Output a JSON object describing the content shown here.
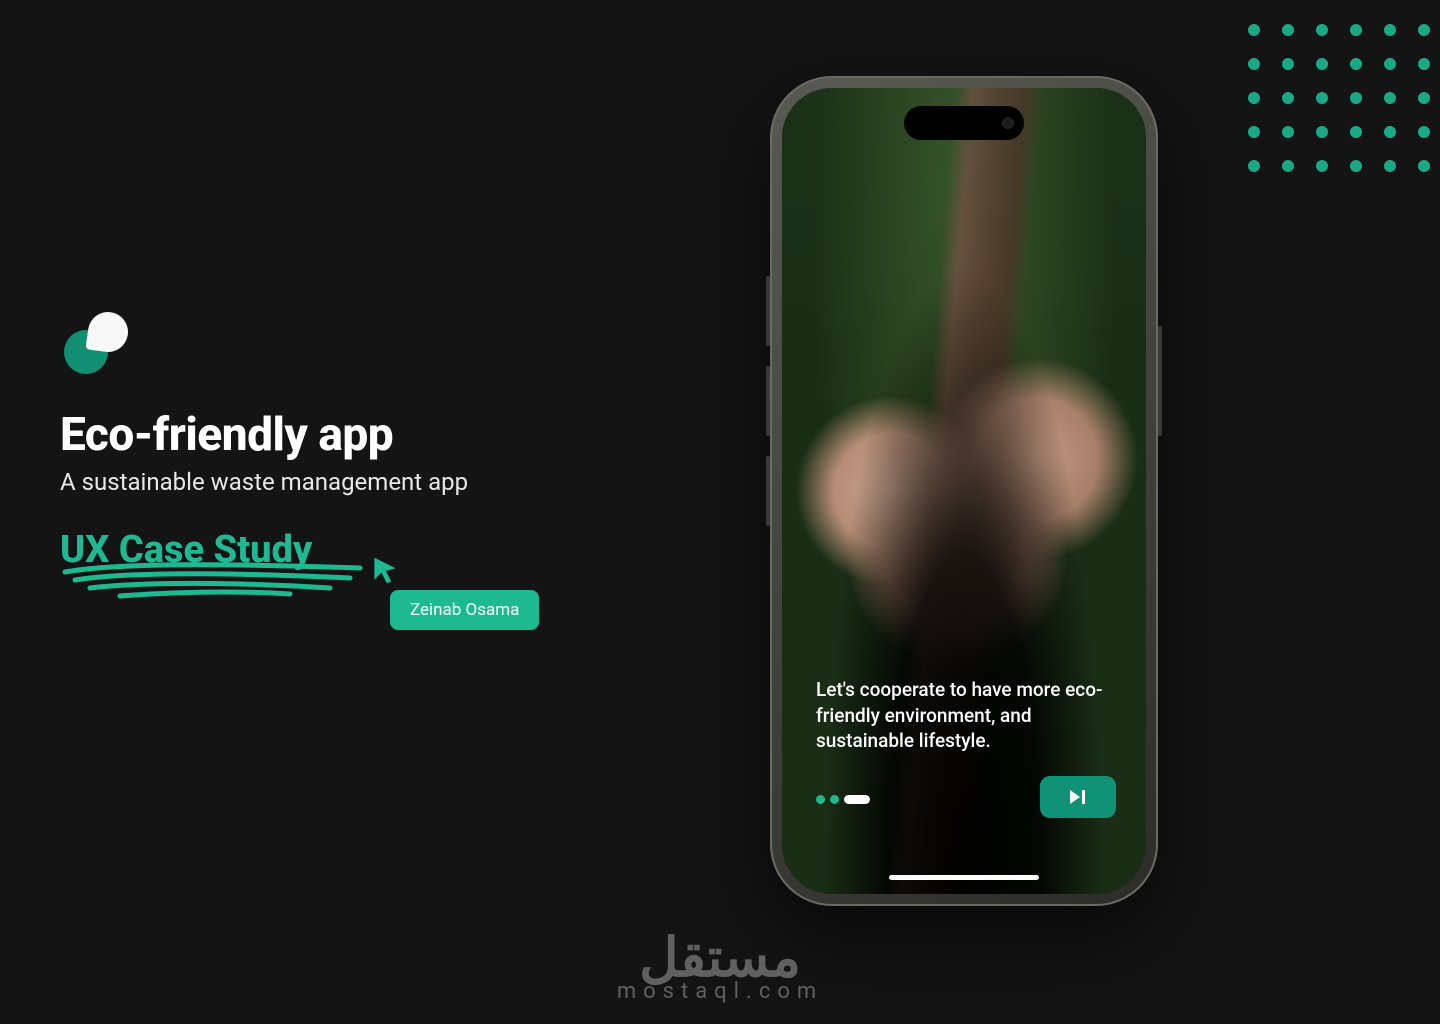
{
  "intro": {
    "title": "Eco-friendly app",
    "subtitle": "A sustainable waste management app",
    "case_study": "UX Case Study",
    "author": "Zeinab Osama"
  },
  "phone": {
    "onboarding_text": "Let's cooperate to have more eco-friendly environment, and sustainable lifestyle.",
    "page_total": 3,
    "page_active": 3
  },
  "watermark": {
    "arabic": "مستقل",
    "latin": "mostaql.com"
  },
  "colors": {
    "accent": "#1dba92",
    "accent_dark": "#109277",
    "bg": "#141414"
  }
}
